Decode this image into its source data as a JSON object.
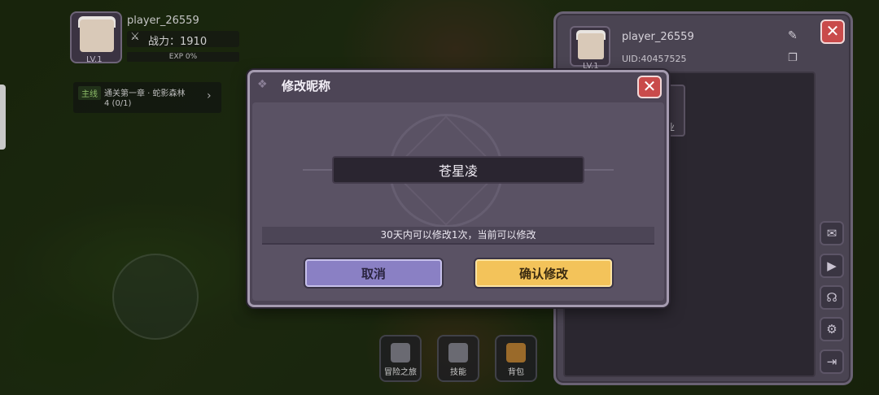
{
  "hud": {
    "player_name": "player_26559",
    "level": "LV.1",
    "power_label": "战力：1910",
    "exp_label": "EXP 0%"
  },
  "quest": {
    "tag": "主线",
    "text": "通关第一章 · 蛇影森林",
    "progress": "4 (0/1)"
  },
  "bottom_bar": [
    {
      "label": "冒险之旅"
    },
    {
      "label": "技能"
    },
    {
      "label": "背包"
    }
  ],
  "profile": {
    "name": "player_26559",
    "uid": "UID:40457525",
    "level": "LV.1",
    "job_label": "业"
  },
  "modal": {
    "title": "修改昵称",
    "input_value": "苍星凌",
    "notice": "30天内可以修改1次，当前可以修改",
    "cancel_label": "取消",
    "confirm_label": "确认修改"
  },
  "icons": {
    "close": "✕",
    "edit": "✎",
    "copy": "❐",
    "mail": "✉",
    "chat": "▶",
    "support": "☊",
    "settings": "⚙",
    "logout": "⇥",
    "gem": "❖",
    "swords": "⚔",
    "arrow": "›"
  },
  "colors": {
    "cancel_button": "#8a80c4",
    "confirm_button": "#f3c35a",
    "close_button": "#c94b4b",
    "modal_bg": "#4d4556"
  }
}
